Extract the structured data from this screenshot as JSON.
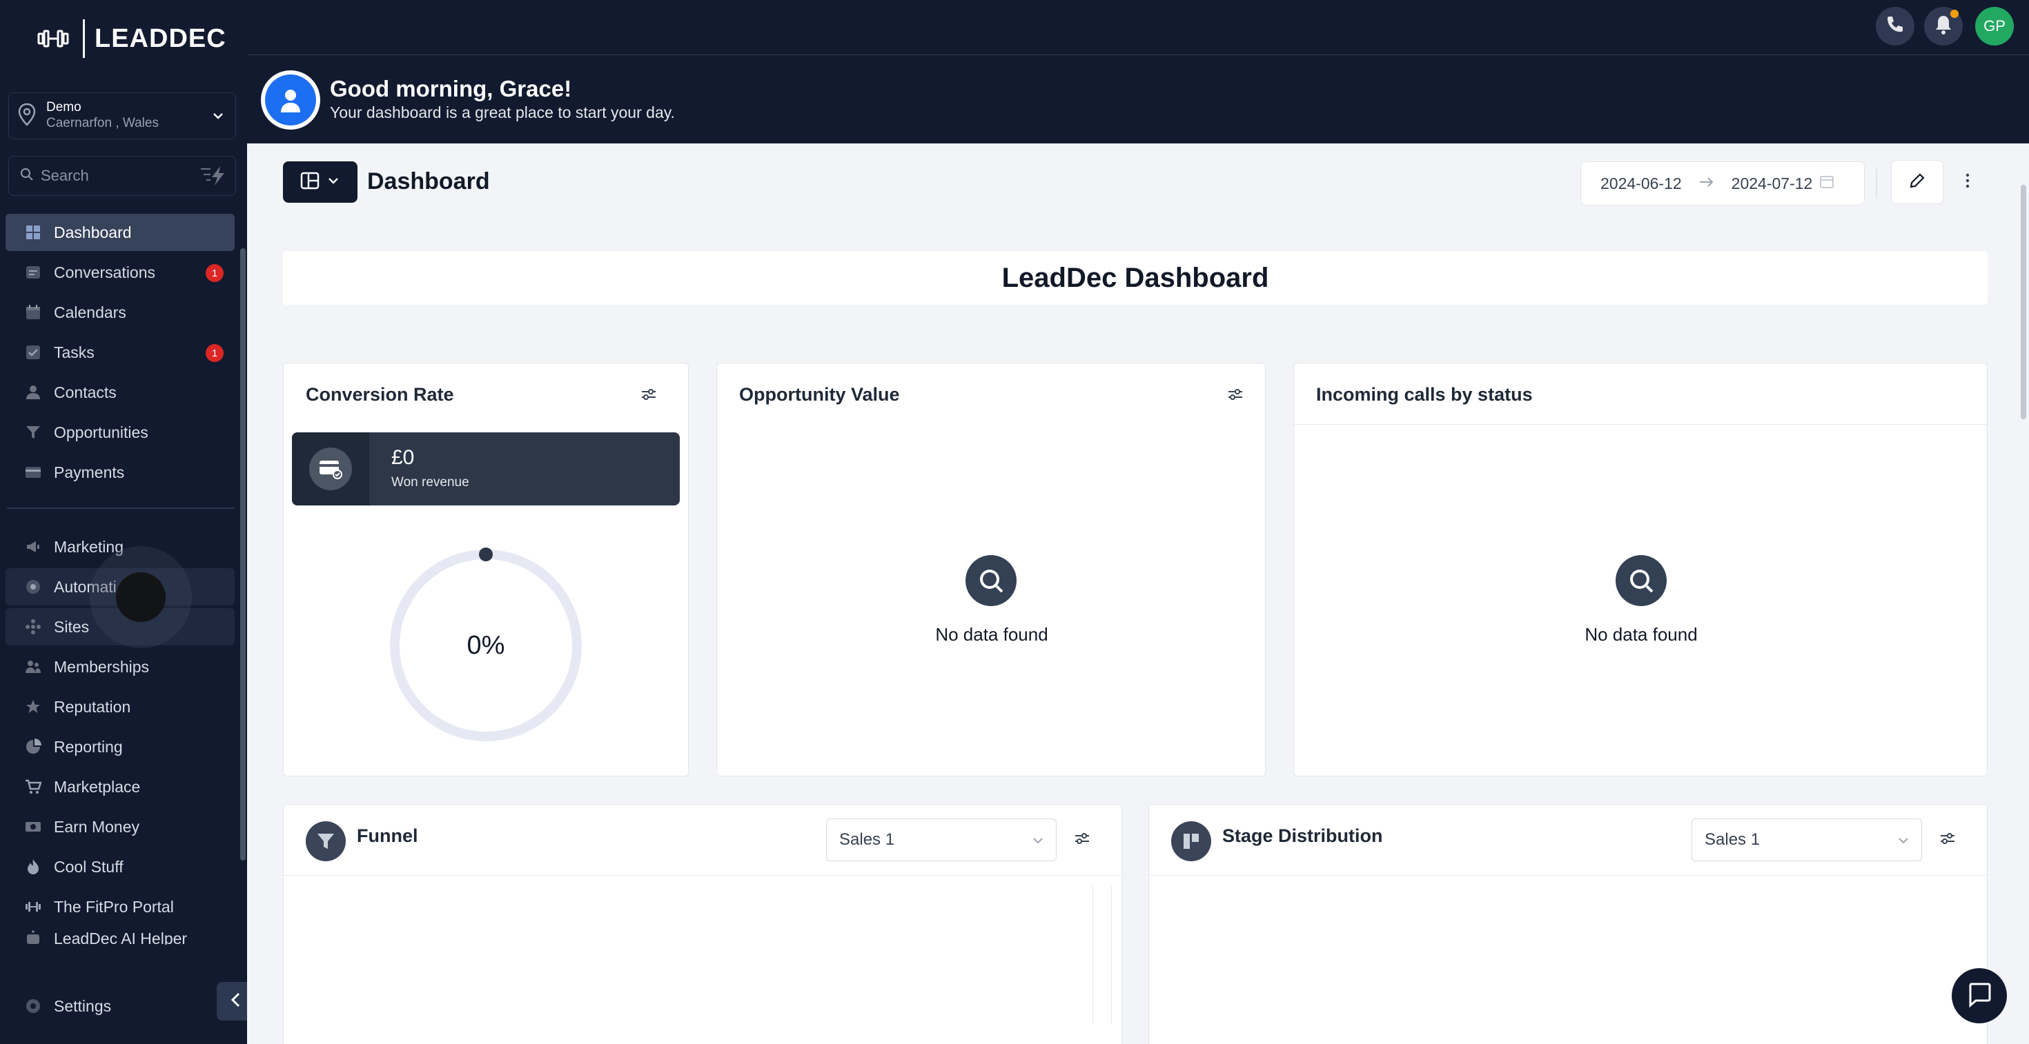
{
  "app": {
    "logo_text": "LEADDEC"
  },
  "location": {
    "name": "Demo",
    "sub": "Caernarfon , Wales"
  },
  "search": {
    "placeholder": "Search"
  },
  "sidebar": {
    "items": [
      {
        "label": "Dashboard",
        "icon": "dashboard-icon",
        "active": true
      },
      {
        "label": "Conversations",
        "icon": "chat-icon",
        "badge": "1"
      },
      {
        "label": "Calendars",
        "icon": "calendar-icon"
      },
      {
        "label": "Tasks",
        "icon": "checkbox-icon",
        "badge": "1"
      },
      {
        "label": "Contacts",
        "icon": "person-icon"
      },
      {
        "label": "Opportunities",
        "icon": "filter-icon"
      },
      {
        "label": "Payments",
        "icon": "card-icon"
      },
      {
        "label": "Marketing",
        "icon": "megaphone-icon"
      },
      {
        "label": "Automati",
        "icon": "automation-icon"
      },
      {
        "label": "Sites",
        "icon": "sites-icon"
      },
      {
        "label": "Memberships",
        "icon": "members-icon"
      },
      {
        "label": "Reputation",
        "icon": "star-icon"
      },
      {
        "label": "Reporting",
        "icon": "pie-icon"
      },
      {
        "label": "Marketplace",
        "icon": "cart-icon"
      },
      {
        "label": "Earn Money",
        "icon": "money-icon"
      },
      {
        "label": "Cool Stuff",
        "icon": "flame-icon"
      },
      {
        "label": "The FitPro Portal",
        "icon": "dumbbell-icon"
      },
      {
        "label": "LeadDec AI Helper",
        "icon": "robot-icon"
      }
    ],
    "settings_label": "Settings"
  },
  "topbar": {
    "avatar_initials": "GP"
  },
  "greeting": {
    "title": "Good morning, Grace!",
    "subtitle": "Your dashboard is a great place to start your day."
  },
  "page": {
    "title": "Dashboard",
    "date_start": "2024-06-12",
    "date_end": "2024-07-12",
    "banner": "LeadDec Dashboard"
  },
  "cards": {
    "conversion": {
      "title": "Conversion Rate",
      "won_value": "£0",
      "won_label": "Won revenue",
      "rate": "0%"
    },
    "opportunity": {
      "title": "Opportunity Value",
      "empty": "No data found"
    },
    "calls": {
      "title": "Incoming calls by status",
      "empty": "No data found"
    },
    "funnel": {
      "title": "Funnel",
      "select": "Sales 1"
    },
    "stage": {
      "title": "Stage Distribution",
      "select": "Sales 1"
    }
  },
  "colors": {
    "sidebar_bg": "#111a2e",
    "accent_blue": "#1d6ff2",
    "badge_red": "#dc2626",
    "avatar_green": "#22a861"
  }
}
